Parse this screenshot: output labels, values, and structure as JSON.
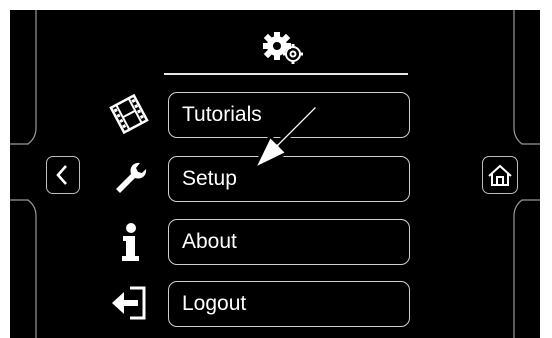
{
  "header": {
    "icon": "gears-icon"
  },
  "menu": {
    "items": [
      {
        "label": "Tutorials",
        "icon": "film-icon"
      },
      {
        "label": "Setup",
        "icon": "wrench-icon"
      },
      {
        "label": "About",
        "icon": "info-icon"
      },
      {
        "label": "Logout",
        "icon": "logout-icon"
      }
    ]
  },
  "navigation": {
    "back_icon": "chevron-left-icon",
    "home_icon": "home-icon"
  },
  "overlay": {
    "pointer_icon": "arrow-pointer-icon"
  },
  "colors": {
    "background": "#000000",
    "foreground": "#ffffff",
    "outline": "#cfcfcf"
  }
}
